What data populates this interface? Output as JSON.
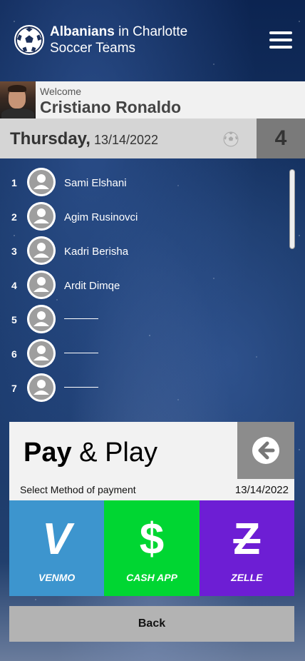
{
  "header": {
    "title_bold": "Albanians",
    "title_rest": " in Charlotte",
    "title_line2": "Soccer Teams"
  },
  "welcome": {
    "label": "Welcome",
    "user_name": "Cristiano Ronaldo"
  },
  "date_bar": {
    "day": "Thursday,",
    "date": "13/14/2022",
    "count": "4"
  },
  "players": [
    {
      "number": "1",
      "name": "Sami Elshani"
    },
    {
      "number": "2",
      "name": "Agim Rusinovci"
    },
    {
      "number": "3",
      "name": "Kadri Berisha"
    },
    {
      "number": "4",
      "name": "Ardit Dimqe"
    },
    {
      "number": "5",
      "name": ""
    },
    {
      "number": "6",
      "name": ""
    },
    {
      "number": "7",
      "name": ""
    }
  ],
  "pay": {
    "title_bold": "Pay",
    "title_rest": " & Play",
    "subtitle": "Select Method of payment",
    "date": "13/14/2022",
    "methods": [
      {
        "label": "VENMO",
        "glyph": "V",
        "color": "#3d95ce"
      },
      {
        "label": "CASH APP",
        "glyph": "$",
        "color": "#00d632"
      },
      {
        "label": "ZELLE",
        "glyph": "Z",
        "color": "#6d1ed4"
      }
    ]
  },
  "back_button": "Back",
  "colors": {
    "background": "#173564",
    "venmo": "#3d95ce",
    "cashapp": "#00d632",
    "zelle": "#6d1ed4"
  }
}
